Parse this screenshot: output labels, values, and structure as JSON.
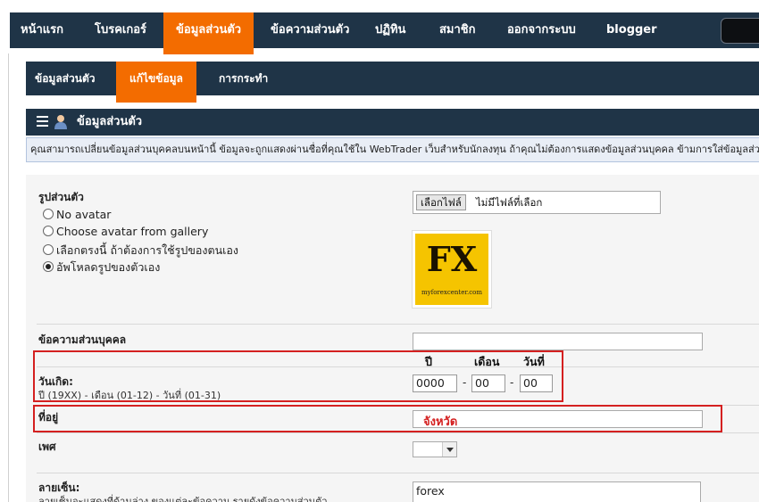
{
  "top_nav": {
    "items": [
      {
        "label": "หน้าแรก"
      },
      {
        "label": "โบรคเกอร์"
      },
      {
        "label": "ข้อมูลส่วนตัว"
      },
      {
        "label": "ข้อความส่วนตัว"
      },
      {
        "label": "ปฏิทิน"
      },
      {
        "label": "สมาชิก"
      },
      {
        "label": "ออกจากระบบ"
      },
      {
        "label": "blogger"
      }
    ],
    "active": "ข้อมูลส่วนตัว"
  },
  "sub_nav": {
    "items": [
      {
        "label": "ข้อมูลส่วนตัว"
      },
      {
        "label": "แก้ไขข้อมูล"
      },
      {
        "label": "การกระทำ"
      }
    ],
    "active": "แก้ไขข้อมูล"
  },
  "section": {
    "title": "ข้อมูลส่วนตัว",
    "info": "คุณสามารถเปลี่ยนข้อมูลส่วนบุคคลบนหน้านี้ ข้อมูลจะถูกแสดงผ่านชื่อที่คุณใช้ใน WebTrader เว็บสำหรับนักลงทุน ถ้าคุณไม่ต้องการแสดงข้อมูลส่วนบุคคล ข้ามการใส่ข้อมูลส่วนนี้ไป"
  },
  "avatar": {
    "label": "รูปส่วนตัว",
    "options": [
      {
        "label": "No avatar",
        "checked": false
      },
      {
        "label": "Choose avatar from gallery",
        "checked": false
      },
      {
        "label": "เลือกตรงนี้ ถ้าต้องการใช้รูปของตนเอง",
        "checked": false
      },
      {
        "label": "อัพโหลดรูปของตัวเอง",
        "checked": true
      }
    ],
    "file_button": "เลือกไฟล์",
    "file_status": "ไม่มีไฟล์ที่เลือก",
    "image_text": "FX",
    "image_site": "myforexcenter.com"
  },
  "bio": {
    "label": "ข้อความส่วนบุคคล",
    "value": ""
  },
  "birthday": {
    "label": "วันเกิด:",
    "hint": "ปี (19XX) - เดือน (01-12) - วันที่ (01-31)",
    "header_year": "ปี",
    "header_month": "เดือน",
    "header_day": "วันที่",
    "year": "0000",
    "month": "00",
    "day": "00",
    "sep": "-"
  },
  "location": {
    "label": "ที่อยู่",
    "annotation": "จังหวัด"
  },
  "gender": {
    "label": "เพศ",
    "value": ""
  },
  "signature": {
    "label": "ลายเซ็น:",
    "hint": "ลายเซ็นจะแสดงที่ด้านล่าง ของแต่ละข้อความ รายดังข้อความส่วนตัว",
    "value": "forex"
  },
  "colors": {
    "nav_bg": "#1f3447",
    "accent": "#f36c00",
    "annotation_red": "#d42020"
  }
}
